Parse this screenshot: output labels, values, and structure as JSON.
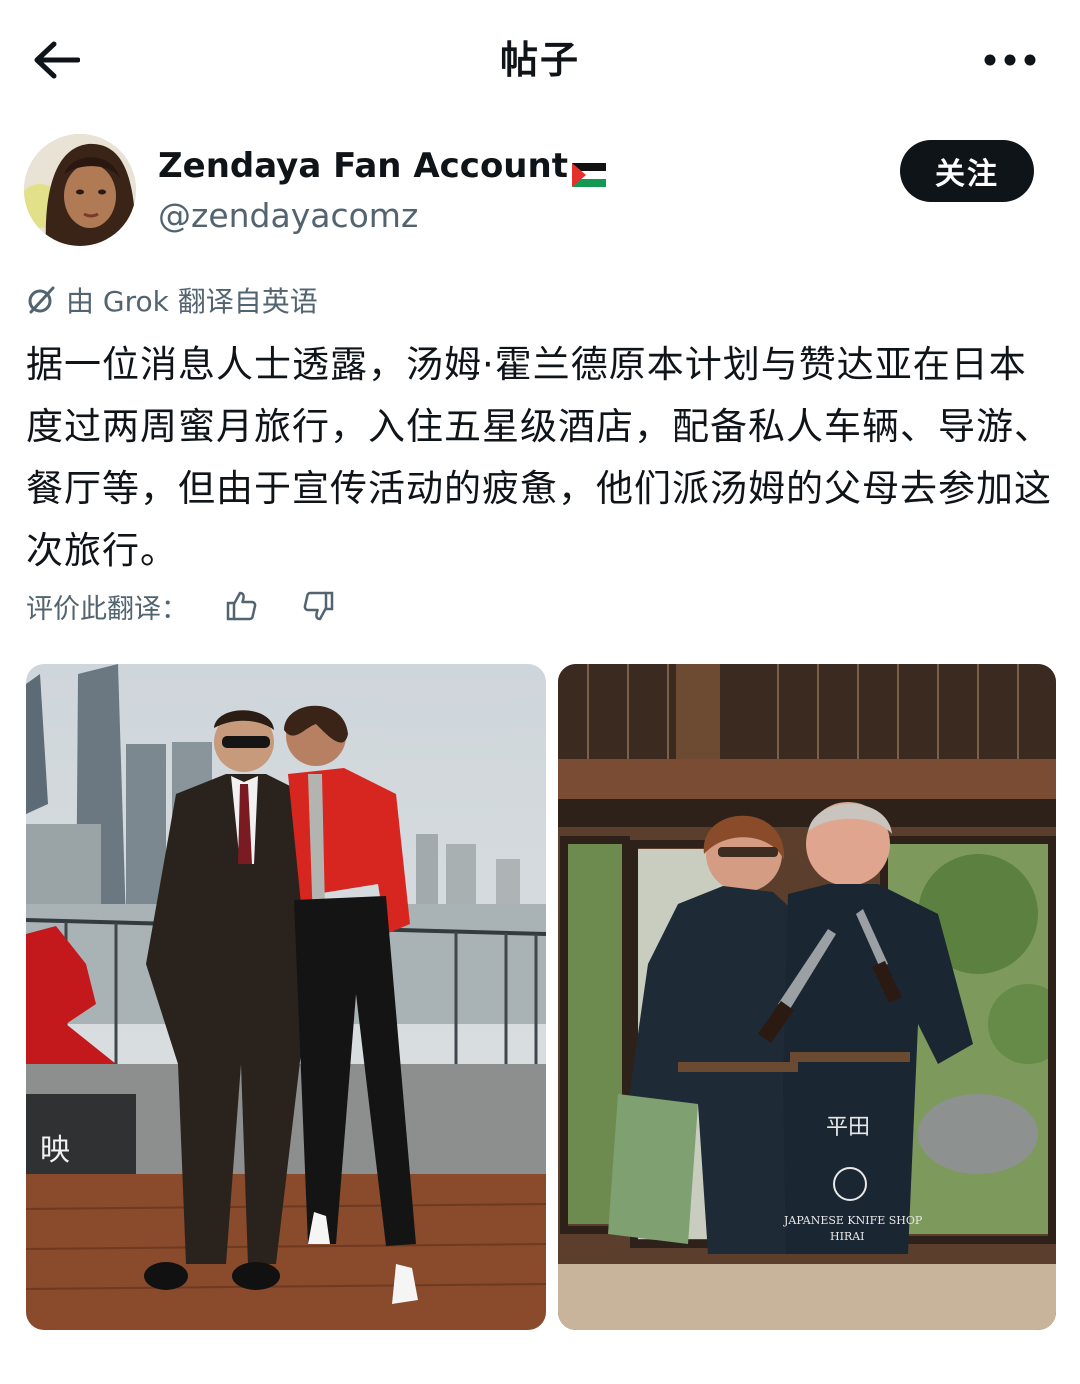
{
  "header": {
    "title": "帖子",
    "back_icon": "arrow-left-icon",
    "more_icon": "more-horizontal-icon"
  },
  "author": {
    "display_name": "Zendaya Fan Account",
    "handle": "@zendayacomz",
    "follow_label": "关注",
    "flag_icon": "palestine-flag-icon"
  },
  "translation": {
    "label": "由 Grok 翻译自英语",
    "icon": "grok-icon"
  },
  "post": {
    "text": "据一位消息人士透露，汤姆·霍兰德原本计划与赞达亚在日本度过两周蜜月旅行，入住五星级酒店，配备私人车辆、导游、餐厅等，但由于宣传活动的疲惫，他们派汤姆的父母去参加这次旅行。"
  },
  "rating": {
    "label": "评价此翻译：",
    "thumbs_up_icon": "thumbs-up-icon",
    "thumbs_down_icon": "thumbs-down-icon"
  },
  "media": {
    "left_sign_text": "映",
    "right_apron_title": "平田",
    "right_apron_text": "JAPANESE KNIFE SHOP",
    "right_apron_sub": "HIRAI"
  },
  "colors": {
    "text_primary": "#0f1419",
    "text_secondary": "#536471",
    "follow_bg": "#0f1419"
  }
}
